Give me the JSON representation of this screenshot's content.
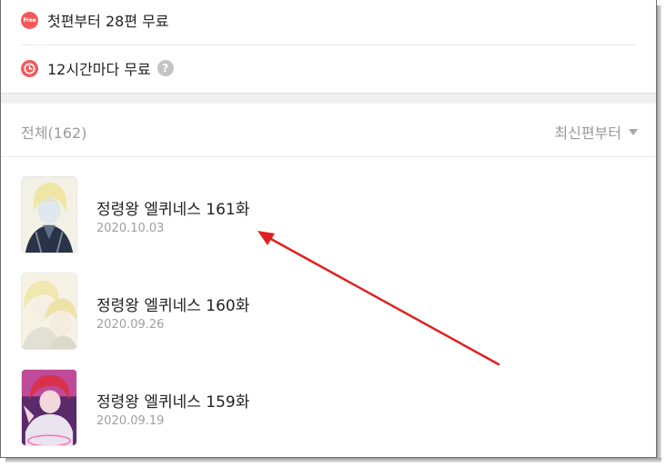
{
  "info": {
    "free_badge_text": "Free",
    "free_text": "첫편부터 28편 무료",
    "timer_text": "12시간마다 무료",
    "help_text": "?"
  },
  "list_header": {
    "total_label": "전체(162)",
    "sort_label": "최신편부터"
  },
  "episodes": [
    {
      "title": "정령왕 엘퀴네스 161화",
      "date": "2020.10.03"
    },
    {
      "title": "정령왕 엘퀴네스 160화",
      "date": "2020.09.26"
    },
    {
      "title": "정령왕 엘퀴네스 159화",
      "date": "2020.09.19"
    }
  ],
  "colors": {
    "accent_red": "#f25a5a",
    "annotation_arrow": "#e02020"
  }
}
